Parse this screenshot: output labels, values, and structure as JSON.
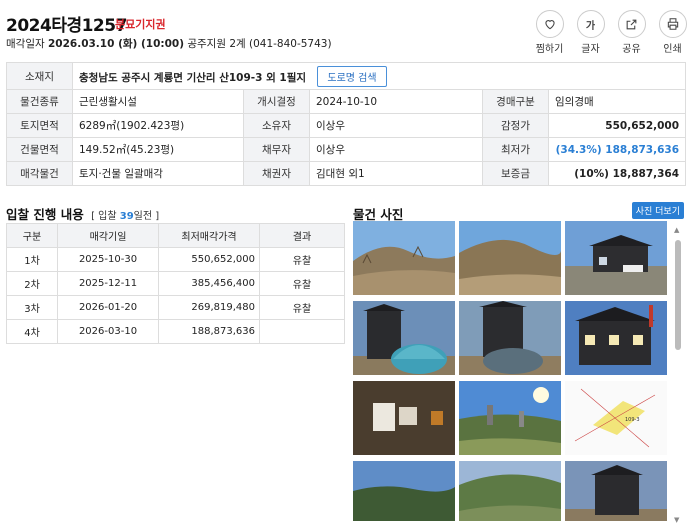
{
  "header": {
    "case_no": "2024타경1257",
    "badge": "분묘기지권",
    "sale_label": "매각일자",
    "sale_date": "2026.03.10 (화) (10:00)",
    "court": "공주지원 2계 (041-840-5743)"
  },
  "actions": [
    {
      "label": "찜하기",
      "icon": "heart-icon"
    },
    {
      "label": "글자",
      "icon": "font-size-icon"
    },
    {
      "label": "공유",
      "icon": "share-icon"
    },
    {
      "label": "인쇄",
      "icon": "print-icon"
    }
  ],
  "info": {
    "address_label": "소재지",
    "address": "충청남도 공주시 계룡면 기산리 산109-3 외 1필지",
    "road_button": "도로명 검색",
    "rows": [
      [
        "물건종류",
        "근린생활시설",
        "개시결정",
        "2024-10-10",
        "경매구분",
        "임의경매"
      ],
      [
        "토지면적",
        "6289㎡(1902.423평)",
        "소유자",
        "이상우",
        "감정가",
        "550,652,000"
      ],
      [
        "건물면적",
        "149.52㎡(45.23평)",
        "채무자",
        "이상우",
        "최저가",
        "(34.3%) 188,873,636"
      ],
      [
        "매각물건",
        "토지·건물 일괄매각",
        "채권자",
        "김대현 외1",
        "보증금",
        "(10%) 18,887,364"
      ]
    ]
  },
  "bids": {
    "title": "입찰 진행 내용",
    "sub_prefix": "[ 입찰 ",
    "days": "39",
    "sub_suffix": "일전 ]",
    "headers": [
      "구분",
      "매각기일",
      "최저매각가격",
      "결과"
    ],
    "rows": [
      [
        "1차",
        "2025-10-30",
        "550,652,000",
        "유찰"
      ],
      [
        "2차",
        "2025-12-11",
        "385,456,400",
        "유찰"
      ],
      [
        "3차",
        "2026-01-20",
        "269,819,480",
        "유찰"
      ],
      [
        "4차",
        "2026-03-10",
        "188,873,636",
        ""
      ]
    ]
  },
  "photos": {
    "title": "물건 사진",
    "more": "사진 더보기"
  }
}
